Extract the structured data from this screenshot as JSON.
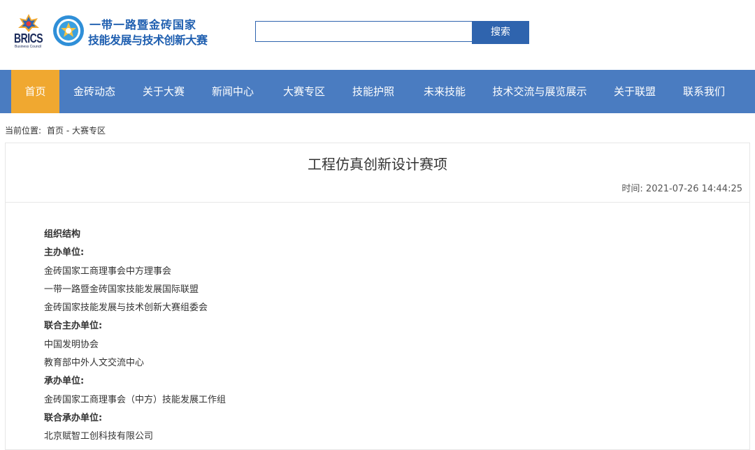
{
  "header": {
    "brics_logo_text": "BRICS",
    "brics_logo_sub": "Business Council",
    "title_line1": "一带一路暨金砖国家",
    "title_line2": "技能发展与技术创新大赛",
    "search": {
      "placeholder": "",
      "value": "",
      "button_label": "搜索"
    }
  },
  "nav": {
    "items": [
      {
        "label": "首页",
        "active": true
      },
      {
        "label": "金砖动态"
      },
      {
        "label": "关于大赛"
      },
      {
        "label": "新闻中心"
      },
      {
        "label": "大赛专区"
      },
      {
        "label": "技能护照"
      },
      {
        "label": "未来技能"
      },
      {
        "label": "技术交流与展览展示"
      },
      {
        "label": "关于联盟"
      },
      {
        "label": "联系我们"
      }
    ],
    "colors": {
      "bar": "#4a7cc1",
      "active": "#f0a830"
    }
  },
  "breadcrumb": {
    "label": "当前位置:",
    "path": "首页 - 大赛专区"
  },
  "article": {
    "title": "工程仿真创新设计赛项",
    "time": "时间: 2021-07-26 14:44:25",
    "lines": [
      {
        "text": "组织结构",
        "bold": true
      },
      {
        "text": "主办单位:",
        "bold": true
      },
      {
        "text": "金砖国家工商理事会中方理事会"
      },
      {
        "text": "一带一路暨金砖国家技能发展国际联盟"
      },
      {
        "text": "金砖国家技能发展与技术创新大赛组委会"
      },
      {
        "text": "联合主办单位:",
        "bold": true
      },
      {
        "text": "中国发明协会"
      },
      {
        "text": "教育部中外人文交流中心"
      },
      {
        "text": "承办单位:",
        "bold": true
      },
      {
        "text": "金砖国家工商理事会（中方）技能发展工作组"
      },
      {
        "text": "联合承办单位:",
        "bold": true
      },
      {
        "text": "北京赋智工创科技有限公司"
      }
    ]
  }
}
